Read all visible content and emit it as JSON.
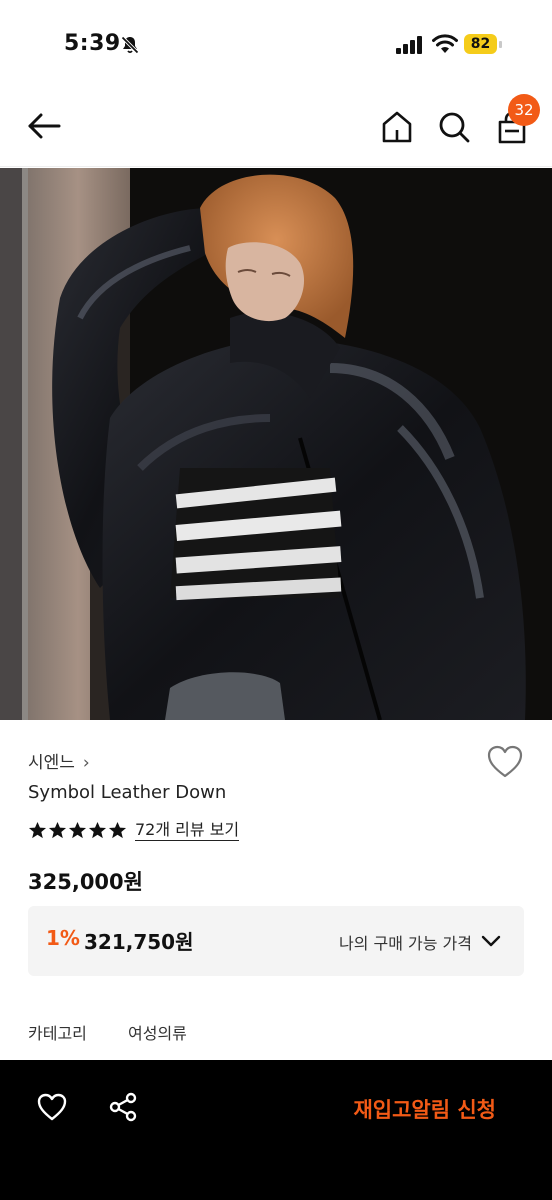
{
  "status": {
    "time": "5:39",
    "battery": "82"
  },
  "header": {
    "cart_count": "32"
  },
  "product": {
    "brand": "시엔느",
    "brand_chevron": "›",
    "name": "Symbol Leather Down",
    "rating_stars": 5,
    "review_link": "72개 리뷰 보기",
    "price": "325,000원",
    "discount_rate": "1%",
    "discounted_price": "321,750원",
    "my_price_label": "나의 구매 가능 가격",
    "category_label": "카테고리",
    "category_value": "여성의류"
  },
  "bottom_bar": {
    "restock_label": "재입고알림 신청"
  },
  "colors": {
    "accent": "#f25a16",
    "battery": "#f5cc1a",
    "bottom_bar_bg": "#000000"
  },
  "icons": [
    "bell-slash-icon",
    "signal-icon",
    "wifi-icon",
    "battery-icon",
    "back-arrow-icon",
    "home-icon",
    "search-icon",
    "shopping-bag-icon",
    "heart-outline-icon",
    "star-icon",
    "chevron-down-icon",
    "share-icon"
  ]
}
